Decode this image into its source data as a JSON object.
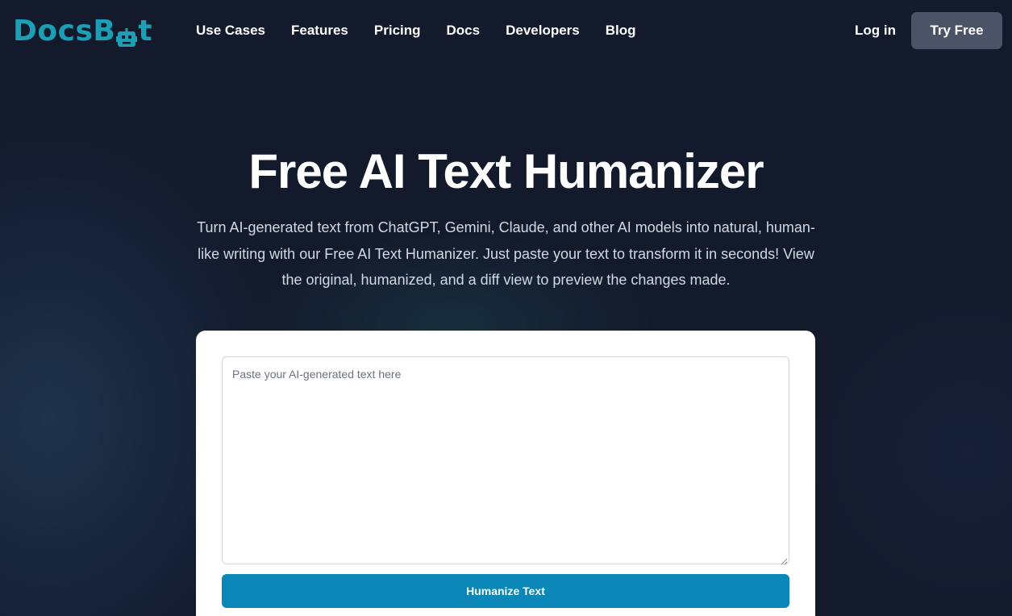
{
  "header": {
    "logo_text_left": "DocsB",
    "logo_text_right": "t",
    "nav": [
      "Use Cases",
      "Features",
      "Pricing",
      "Docs",
      "Developers",
      "Blog"
    ],
    "login_label": "Log in",
    "try_label": "Try Free"
  },
  "hero": {
    "title": "Free AI Text Humanizer",
    "subtitle": "Turn AI-generated text from ChatGPT, Gemini, Claude, and other AI models into natural, human-like writing with our Free AI Text Humanizer. Just paste your text to transform it in seconds! View the original, humanized, and a diff view to preview the changes made."
  },
  "tool": {
    "input_placeholder": "Paste your AI-generated text here",
    "input_value": "",
    "button_label": "Humanize Text"
  },
  "colors": {
    "background": "#131a2c",
    "brand": "#1c9fb5",
    "primary_button": "#0a87b7",
    "try_button": "#4b5466"
  },
  "icons": {
    "logo": "robot-icon",
    "resize": "resize-grip-icon"
  }
}
